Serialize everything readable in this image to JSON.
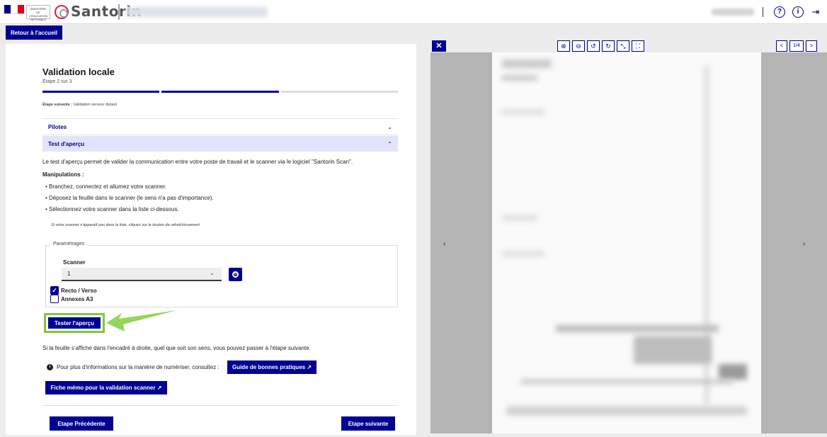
{
  "header": {
    "app_name": "Santorin",
    "ministry_lines": [
      "MINISTÈRE",
      "DE L'ÉDUCATION",
      "NATIONALE"
    ],
    "flag_colors": [
      "#000091",
      "#ffffff",
      "#e1000f"
    ],
    "icons": [
      "help-icon",
      "info-icon",
      "logout-icon"
    ],
    "help_glyph": "?",
    "info_glyph": "i",
    "logout_glyph": "⇥"
  },
  "nav": {
    "back_label": "Retour à l'accueil"
  },
  "form": {
    "title": "Validation locale",
    "step_text": "Étape 2 sur 3",
    "stepper_colors": {
      "done": "#000091",
      "todo": "#dddddd"
    },
    "steps_done": 2,
    "steps_total": 3,
    "next_step_prefix": "Étape suivante :",
    "next_step_name": "Validation serveur distant",
    "accordion": [
      {
        "label": "Pilotes",
        "chevron": "⌄",
        "open": false
      },
      {
        "label": "Test d'aperçu",
        "chevron": "⌃",
        "open": true
      }
    ],
    "intro": "Le test d'aperçu permet de valider la communication entre votre poste de travail et le scanner via le logiciel \"Santorin Scan\".",
    "manip_title": "Manipulations :",
    "bullets": [
      "• Branchez, connectez et allumez votre scanner.",
      "• Déposez la feuille dans le scanner (le sens n'a pas d'importance).",
      "• Sélectionnez votre scanner dans la liste ci-dessous."
    ],
    "note": "Si votre scanner n'apparaît pas dans la liste, cliquez sur le bouton de rafraîchissement",
    "settings": {
      "legend": "Paramétrages",
      "scanner_label": "Scanner",
      "scanner_value": "1",
      "select_arrow": "⌄",
      "refresh_glyph": "↻",
      "recto_verso_label": "Recto / Verso",
      "recto_verso_checked": true,
      "check_glyph": "✓",
      "annexes_label": "Annexes A3",
      "annexes_checked": false
    },
    "test_button": "Tester l'aperçu",
    "highlight_color": "#7dc93a",
    "after_text": "Si la feuille s'affiche dans l'encadré à droite, quel que soit son sens, vous pouvez passer à l'étape suivante.",
    "info_glyph": "i",
    "info_text": "Pour plus d'informations sur la manière de numériser, consultez :",
    "guide_button": "Guide de bonnes pratiques ↗",
    "memo_button": "Fiche mémo pour la validation scanner ↗",
    "prev_button": "Etape Précédente",
    "next_button": "Etape suivante"
  },
  "viewer": {
    "close_glyph": "✕",
    "tools": [
      {
        "name": "zoom-in-icon",
        "glyph": "⊕"
      },
      {
        "name": "zoom-out-icon",
        "glyph": "⊖"
      },
      {
        "name": "rotate-left-icon",
        "glyph": "↺"
      },
      {
        "name": "rotate-right-icon",
        "glyph": "↻"
      },
      {
        "name": "fit-icon",
        "glyph": "⤡"
      },
      {
        "name": "fullscreen-icon",
        "glyph": "⛶"
      }
    ],
    "page_prev_glyph": "<",
    "page_next_glyph": ">",
    "page_indicator": "1/4",
    "nav_prev_glyph": "‹",
    "nav_next_glyph": "›"
  }
}
